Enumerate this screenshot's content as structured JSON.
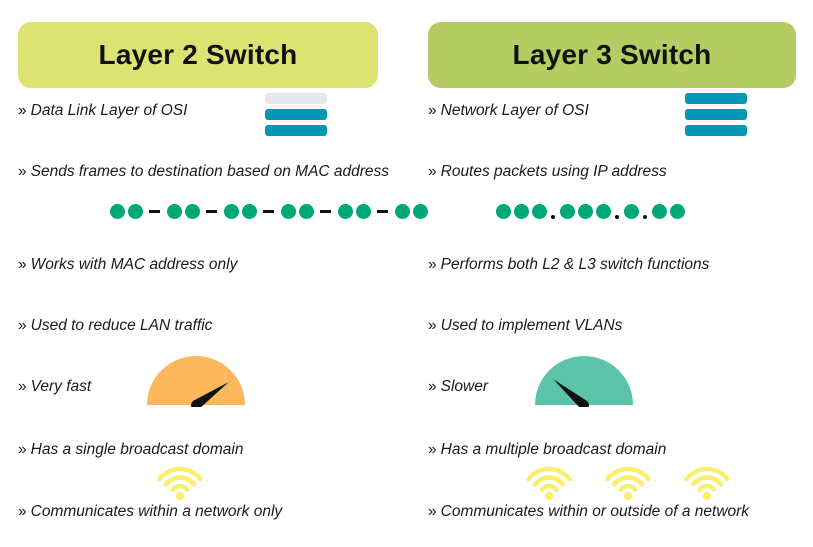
{
  "page": {
    "title": "Layer 2 Switch vs Layer 3 Switch comparison",
    "background": "#ffffff",
    "text_color": "#1a1a1a",
    "bullet_marker": "»"
  },
  "palette": {
    "header_left": "#dde372",
    "header_right": "#b5cc62",
    "layer_bar_teal": "#0198b5",
    "layer_bar_muted": "#e6e7e9",
    "address_dot_green": "#00a878",
    "separator_black": "#111111",
    "gauge_orange": "#fbb85c",
    "gauge_green": "#5bc3a7",
    "needle_black": "#111111",
    "wifi_yellow": "#f9ef6a"
  },
  "columns": [
    {
      "id": "layer-2",
      "header": {
        "label": "Layer 2 Switch",
        "color": "#dde372"
      },
      "bullets": [
        {
          "text": "Data Link Layer of OSI"
        },
        {
          "text": "Sends frames to destination based on MAC address"
        },
        {
          "text": "Works with MAC address only"
        },
        {
          "text": "Used to reduce LAN traffic"
        },
        {
          "text": "Very fast"
        },
        {
          "text": "Has a single broadcast domain"
        },
        {
          "text": "Communicates within a network only"
        }
      ],
      "graphics": {
        "layers_icon": {
          "name": "osi-layer-bars-icon",
          "bars": [
            "muted",
            "teal",
            "teal"
          ],
          "description": "Three stacked bars, top bar greyed out, lower two highlighted"
        },
        "address": {
          "name": "mac-address-icon",
          "format": "MAC",
          "groups": [
            2,
            2,
            2,
            2,
            2,
            2
          ],
          "separator": "dash",
          "dot_count": 12
        },
        "gauge": {
          "name": "speed-gauge-fast-icon",
          "color": "#fbb85c",
          "needle_angle_deg": -35,
          "label": "Very fast"
        },
        "wifi": {
          "name": "broadcast-domain-icon",
          "count": 1,
          "color": "#f9ef6a",
          "arcs": 3
        }
      }
    },
    {
      "id": "layer-3",
      "header": {
        "label": "Layer 3 Switch",
        "color": "#b5cc62"
      },
      "bullets": [
        {
          "text": "Network Layer of OSI"
        },
        {
          "text": "Routes packets using IP address"
        },
        {
          "text": "Performs both L2 & L3 switch functions"
        },
        {
          "text": "Used to implement VLANs"
        },
        {
          "text": "Slower"
        },
        {
          "text": "Has a multiple broadcast domain"
        },
        {
          "text": "Communicates within or outside of a network"
        }
      ],
      "graphics": {
        "layers_icon": {
          "name": "osi-layer-bars-icon",
          "bars": [
            "teal",
            "teal",
            "teal"
          ],
          "description": "Three stacked bars, all highlighted"
        },
        "address": {
          "name": "ip-address-icon",
          "format": "IP",
          "groups": [
            3,
            3,
            1,
            2
          ],
          "separator": "dot",
          "dot_count": 9
        },
        "gauge": {
          "name": "speed-gauge-slow-icon",
          "color": "#5bc3a7",
          "needle_angle_deg": -140,
          "label": "Slower"
        },
        "wifi": {
          "name": "broadcast-domain-icon",
          "count": 3,
          "color": "#f9ef6a",
          "arcs": 3
        }
      }
    }
  ]
}
